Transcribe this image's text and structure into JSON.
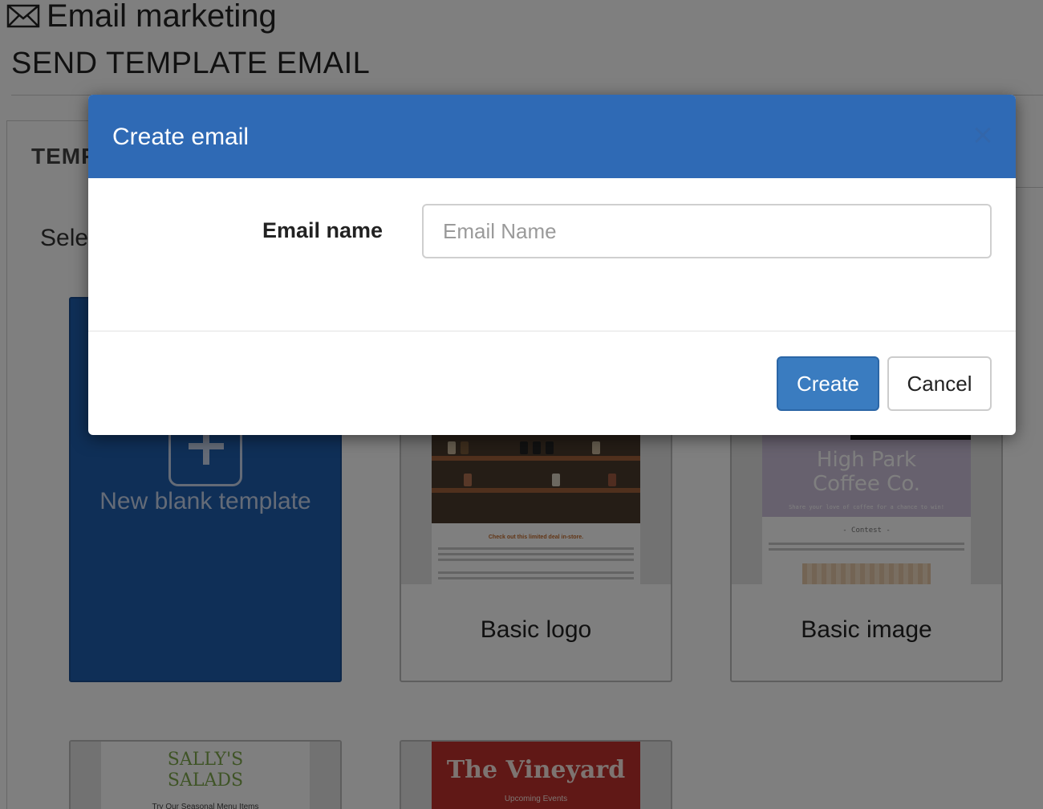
{
  "app": {
    "title": "Email marketing",
    "icon": "envelope-icon"
  },
  "page": {
    "title": "SEND TEMPLATE EMAIL",
    "tab_label": "TEMP",
    "select_label": "Sele"
  },
  "templates": {
    "blank": {
      "label": "New blank template",
      "icon": "plus-icon"
    },
    "basic_logo": {
      "label": "Basic logo",
      "caption": "Check out this limited deal in-store."
    },
    "basic_image": {
      "label": "Basic image",
      "title_line1": "High Park",
      "title_line2": "Coffee Co.",
      "subtitle": "Share your love of coffee for a chance to win!",
      "contest": "- Contest -"
    },
    "salads": {
      "title_line1": "SALLY'S",
      "title_line2": "SALADS",
      "subtitle": "Try Our Seasonal Menu Items"
    },
    "vineyard": {
      "title": "The Vineyard",
      "subtitle": "Upcoming Events"
    }
  },
  "modal": {
    "title": "Create email",
    "close_symbol": "×",
    "field_label": "Email name",
    "field_placeholder": "Email Name",
    "field_value": "",
    "create_label": "Create",
    "cancel_label": "Cancel"
  },
  "colors": {
    "header_blue": "#2f6ab5",
    "create_button": "#3a7cc0",
    "blank_card": "#1f5fae"
  }
}
